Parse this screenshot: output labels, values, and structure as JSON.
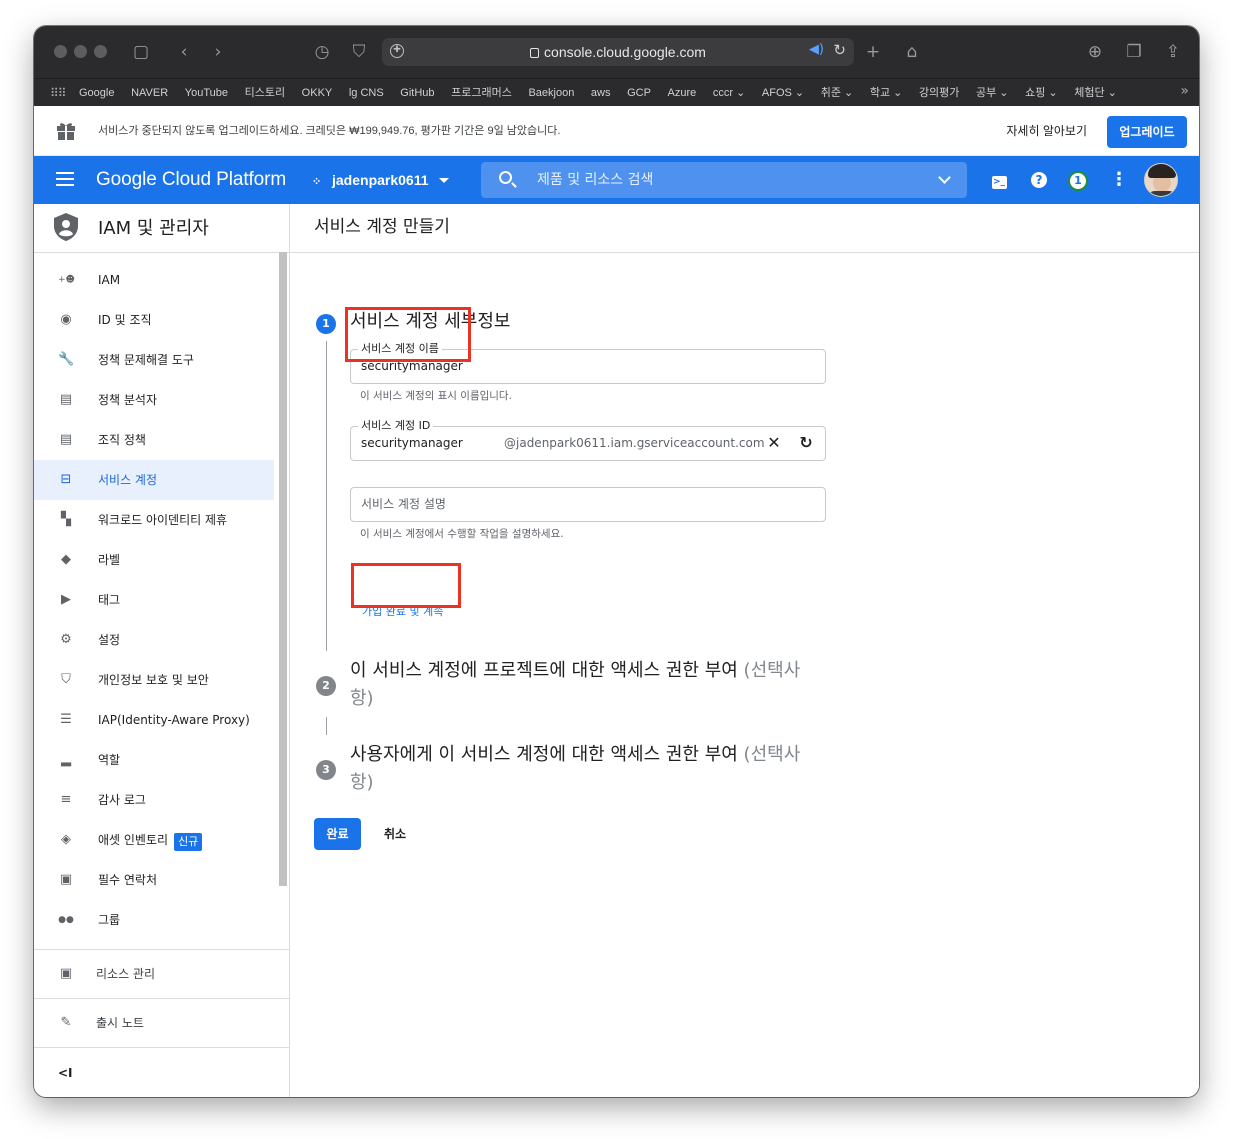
{
  "browser": {
    "url": "console.cloud.google.com",
    "favorites": [
      "Google",
      "NAVER",
      "YouTube",
      "티스토리",
      "OKKY",
      "lg CNS",
      "GitHub",
      "프로그래머스",
      "Baekjoon",
      "aws",
      "GCP",
      "Azure",
      "cccr ⌄",
      "AFOS ⌄",
      "취준 ⌄",
      "학교 ⌄",
      "강의평가",
      "공부 ⌄",
      "쇼핑 ⌄",
      "체험단 ⌄"
    ]
  },
  "promo": {
    "text": "서비스가 중단되지 않도록 업그레이드하세요. 크레딧은 ₩199,949.76, 평가판 기간은 9일 남았습니다.",
    "learn_more": "자세히 알아보기",
    "upgrade": "업그레이드"
  },
  "header": {
    "brand": "Google Cloud Platform",
    "project": "jadenpark0611",
    "search_placeholder": "제품 및 리소스 검색",
    "notification_count": "1",
    "accent": "#1a73e8"
  },
  "sidebar": {
    "title": "IAM 및 관리자",
    "items": [
      {
        "label": "IAM",
        "icon": "add-person-icon"
      },
      {
        "label": "ID 및 조직",
        "icon": "account-circle-icon"
      },
      {
        "label": "정책 문제해결 도구",
        "icon": "wrench-icon"
      },
      {
        "label": "정책 분석자",
        "icon": "document-search-icon"
      },
      {
        "label": "조직 정책",
        "icon": "list-document-icon"
      },
      {
        "label": "서비스 계정",
        "icon": "service-account-icon"
      },
      {
        "label": "워크로드 아이덴티티 제휴",
        "icon": "grid-icon"
      },
      {
        "label": "라벨",
        "icon": "label-icon"
      },
      {
        "label": "태그",
        "icon": "tag-icon"
      },
      {
        "label": "설정",
        "icon": "gear-icon"
      },
      {
        "label": "개인정보 보호 및 보안",
        "icon": "shield-icon"
      },
      {
        "label": "IAP(Identity-Aware Proxy)",
        "icon": "proxy-icon"
      },
      {
        "label": "역할",
        "icon": "hat-icon"
      },
      {
        "label": "감사 로그",
        "icon": "lines-icon"
      },
      {
        "label": "애셋 인벤토리",
        "icon": "diamond-icon",
        "badge": "신규"
      },
      {
        "label": "필수 연락처",
        "icon": "contact-icon"
      },
      {
        "label": "그룹",
        "icon": "group-icon"
      }
    ],
    "footer": [
      {
        "label": "리소스 관리",
        "icon": "folder-gear-icon"
      },
      {
        "label": "출시 노트",
        "icon": "notes-icon"
      }
    ],
    "collapse": "<I"
  },
  "main": {
    "title": "서비스 계정 만들기",
    "step1": {
      "number": "1",
      "title": "서비스 계정 세부정보",
      "name_label": "서비스 계정 이름",
      "name_value": "securitymanager",
      "name_hint": "이 서비스 계정의 표시 이름입니다.",
      "id_label": "서비스 계정 ID",
      "id_value": "securitymanager",
      "id_suffix": "@jadenpark0611.iam.gserviceaccount.com",
      "desc_placeholder": "서비스 계정 설명",
      "desc_hint": "이 서비스 계정에서 수행할 작업을 설명하세요.",
      "continue": "가입 완료 및 계속"
    },
    "step2": {
      "number": "2",
      "title": "이 서비스 계정에 프로젝트에 대한 액세스 권한 부여",
      "optional_a": "(선택사",
      "optional_b": "항)"
    },
    "step3": {
      "number": "3",
      "title": "사용자에게 이 서비스 계정에 대한 액세스 권한 부여",
      "optional_a": "(선택사",
      "optional_b": "항)"
    },
    "done": "완료",
    "cancel": "취소"
  },
  "highlight_color": "#ea3323"
}
